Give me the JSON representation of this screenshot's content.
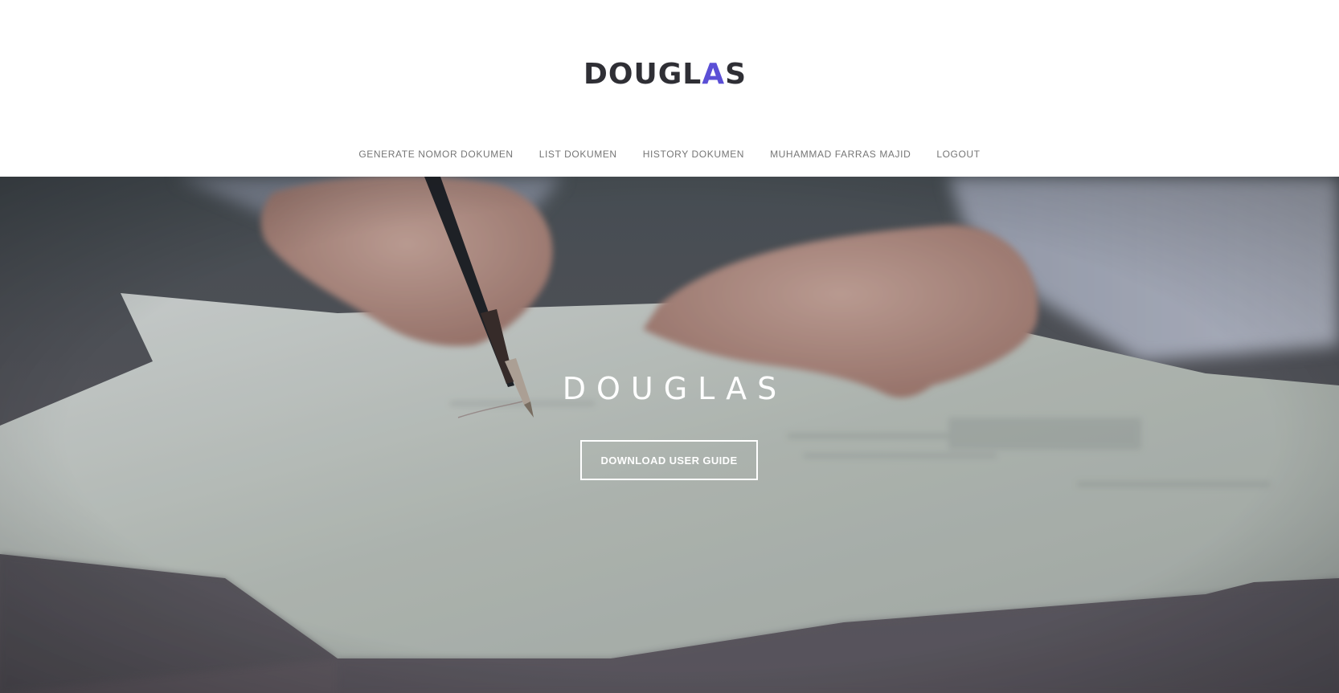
{
  "header": {
    "logo": {
      "text_before": "DOUGL",
      "accent_letter": "A",
      "text_after": "S",
      "dark_color": "#2f2f35",
      "accent_color": "#5b4fd6"
    },
    "nav": [
      {
        "label": "GENERATE NOMOR DOKUMEN"
      },
      {
        "label": "LIST DOKUMEN"
      },
      {
        "label": "HISTORY DOKUMEN"
      },
      {
        "label": "MUHAMMAD FARRAS MAJID"
      },
      {
        "label": "LOGOUT"
      }
    ]
  },
  "hero": {
    "title": "DOUGLAS",
    "button_label": "DOWNLOAD USER GUIDE",
    "background_image": "hand-writing-on-paper-photo"
  }
}
